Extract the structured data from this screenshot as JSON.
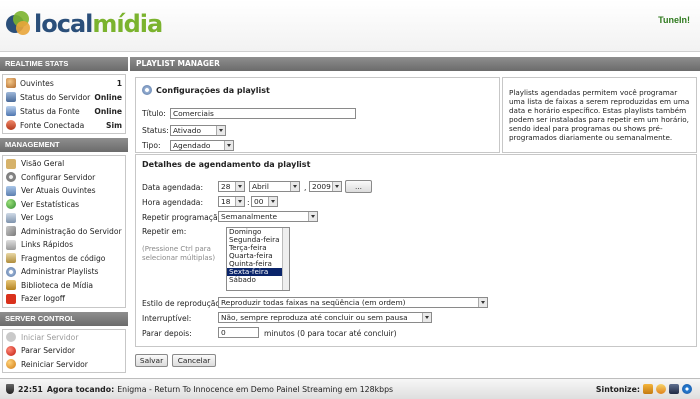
{
  "brand": {
    "name_a": "local",
    "name_b": "mídia",
    "tunein": "TuneIn!"
  },
  "realtime": {
    "title": "REALTIME STATS",
    "rows": [
      {
        "label": "Ouvintes",
        "value": "1"
      },
      {
        "label": "Status do Servidor",
        "value": "Online"
      },
      {
        "label": "Status da Fonte",
        "value": "Online"
      },
      {
        "label": "Fonte Conectada",
        "value": "Sim"
      }
    ]
  },
  "management": {
    "title": "MANAGEMENT",
    "items": [
      "Visão Geral",
      "Configurar Servidor",
      "Ver Atuais Ouvintes",
      "Ver Estatísticas",
      "Ver Logs",
      "Administração do Servidor",
      "Links Rápidos",
      "Fragmentos de código",
      "Administrar Playlists",
      "Biblioteca de Mídia",
      "Fazer logoff"
    ]
  },
  "server_control": {
    "title": "SERVER CONTROL",
    "items": [
      "Iniciar Servidor",
      "Parar Servidor",
      "Reiniciar Servidor"
    ]
  },
  "main": {
    "title": "PLAYLIST MANAGER",
    "config": {
      "title": "Configurações da playlist",
      "title_label": "Título:",
      "title_value": "Comerciais",
      "status_label": "Status:",
      "status_value": "Ativado",
      "type_label": "Tipo:",
      "type_value": "Agendado"
    },
    "info": "Playlists agendadas permitem você programar uma lista de faixas a serem reproduzidas em uma data e horário específico. Estas playlists também podem ser instaladas para repetir em um horário, sendo ideal para programas ou shows pré-programados diariamente ou semanalmente.",
    "schedule": {
      "title": "Detalhes de agendamento da playlist",
      "date_label": "Data agendada:",
      "day": "28",
      "month": "Abril",
      "year": "2009",
      "date_btn": "...",
      "time_label": "Hora agendada:",
      "hour": "18",
      "minute": "00",
      "repeat_label": "Repetir programação:",
      "repeat_value": "Semanalmente",
      "repeat_on_label": "Repetir em:",
      "repeat_hint": "(Pressione Ctrl para selecionar múltiplas)",
      "days": [
        "Domingo",
        "Segunda-feira",
        "Terça-feira",
        "Quarta-feira",
        "Quinta-feira",
        "Sexta-feira",
        "Sábado"
      ],
      "selected_day": "Sexta-feira",
      "playback_label": "Estilo de reprodução:",
      "playback_value": "Reproduzir todas faixas na seqüência (em ordem)",
      "interrupt_label": "Interruptível:",
      "interrupt_value": "Não, sempre reproduza até concluir ou sem pausa",
      "stop_label": "Parar depois:",
      "stop_value": "0",
      "stop_suffix": "minutos (0 para tocar até concluir)"
    },
    "save": "Salvar",
    "cancel": "Cancelar"
  },
  "nowplaying": {
    "time": "22:51",
    "label": "Agora tocando:",
    "track": "Enigma - Return To Innocence em Demo Painel Streaming em 128kbps",
    "tune_label": "Sintonize:"
  }
}
